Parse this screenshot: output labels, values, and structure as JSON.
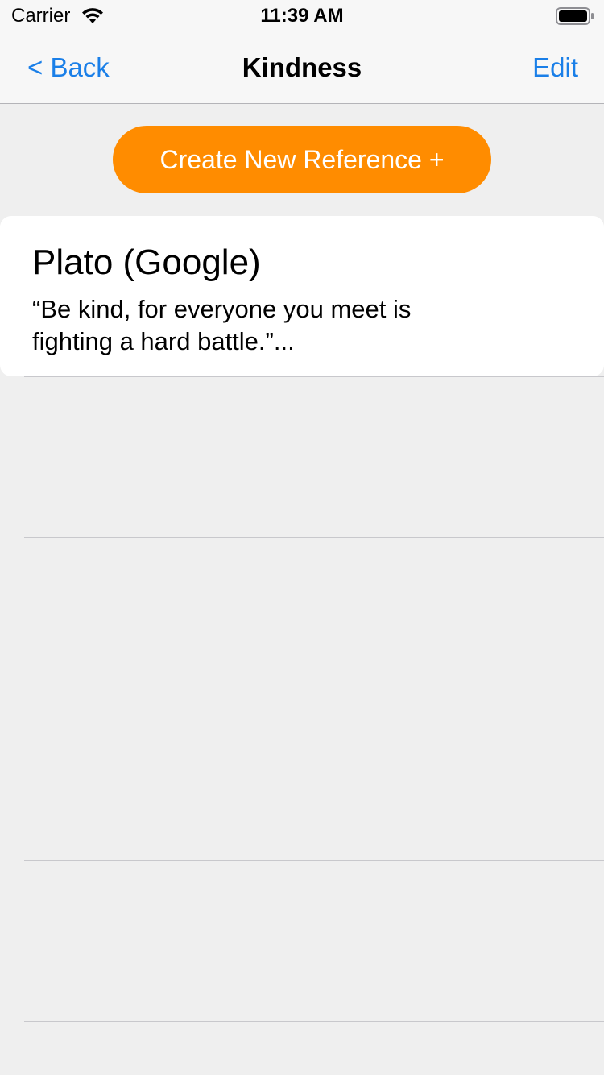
{
  "status_bar": {
    "carrier": "Carrier",
    "time": "11:39 AM",
    "icons": [
      "wifi-icon",
      "battery-icon"
    ]
  },
  "nav": {
    "back_label": "< Back",
    "title": "Kindness",
    "edit_label": "Edit"
  },
  "create_button": {
    "label": "Create New Reference +",
    "color": "#ff8c00"
  },
  "references": [
    {
      "title": "Plato (Google)",
      "quote": "“Be kind, for everyone you meet is fighting a hard battle.”..."
    }
  ],
  "colors": {
    "accent": "#1a7fe8",
    "background": "#efefef"
  }
}
